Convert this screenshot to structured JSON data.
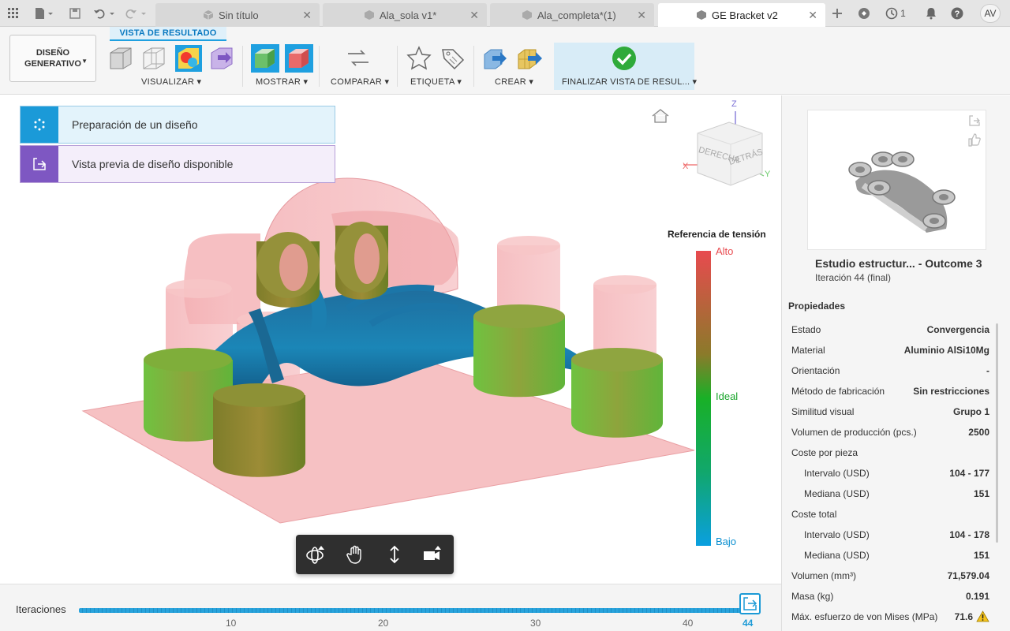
{
  "tabs": [
    {
      "label": "Sin título",
      "active": false
    },
    {
      "label": "Ala_sola v1*",
      "active": false
    },
    {
      "label": "Ala_completa*(1)",
      "active": false
    },
    {
      "label": "GE Bracket v2",
      "active": true
    }
  ],
  "topbar": {
    "jobs_count": "1",
    "user_initials": "AV"
  },
  "ribbon": {
    "workspace_line1": "DISEÑO",
    "workspace_line2": "GENERATIVO",
    "active_tab": "VISTA DE RESULTADO",
    "groups": {
      "visualizar": "VISUALIZAR",
      "mostrar": "MOSTRAR",
      "comparar": "COMPARAR",
      "etiqueta": "ETIQUETA",
      "crear": "CREAR",
      "finalizar": "FINALIZAR VISTA DE RESUL..."
    }
  },
  "notices": [
    {
      "text": "Preparación de un diseño"
    },
    {
      "text": "Vista previa de diseño disponible"
    }
  ],
  "viewcube": {
    "front": "DERECHA",
    "back": "DETRÁS",
    "axis_x": "X",
    "axis_y": "Y",
    "axis_z": "Z"
  },
  "legend": {
    "title": "Referencia de tensión",
    "high": "Alto",
    "ideal": "Ideal",
    "low": "Bajo"
  },
  "iterations": {
    "label": "Iteraciones",
    "ticks": [
      "10",
      "20",
      "30",
      "40"
    ],
    "current": "44"
  },
  "panel": {
    "outcome_title": "Estudio estructur... - Outcome 3",
    "outcome_subtitle": "Iteración 44 (final)",
    "properties_header": "Propiedades",
    "properties": [
      {
        "label": "Estado",
        "value": "Convergencia"
      },
      {
        "label": "Material",
        "value": "Aluminio AlSi10Mg"
      },
      {
        "label": "Orientación",
        "value": "-"
      },
      {
        "label": "Método de fabricación",
        "value": "Sin restricciones"
      },
      {
        "label": "Similitud visual",
        "value": "Grupo 1"
      },
      {
        "label": "Volumen de producción (pcs.)",
        "value": "2500"
      },
      {
        "label": "Coste por pieza",
        "value": ""
      },
      {
        "label": "Intervalo (USD)",
        "value": "104 - 177"
      },
      {
        "label": "Mediana (USD)",
        "value": "151"
      },
      {
        "label": "Coste total",
        "value": ""
      },
      {
        "label": "Intervalo (USD)",
        "value": "104 - 178"
      },
      {
        "label": "Mediana (USD)",
        "value": "151"
      },
      {
        "label": "Volumen (mm³)",
        "value": "71,579.04"
      },
      {
        "label": "Masa (kg)",
        "value": "0.191"
      },
      {
        "label": "Máx. esfuerzo de von Mises (MPa)",
        "value": "71.6"
      }
    ]
  },
  "colors": {
    "accent": "#1fa0e0",
    "purple": "#7e57c2",
    "stress_high": "#e84a4f",
    "stress_ideal": "#19b027",
    "stress_low": "#0a9fe0",
    "preserve": "#f4b8bb"
  }
}
